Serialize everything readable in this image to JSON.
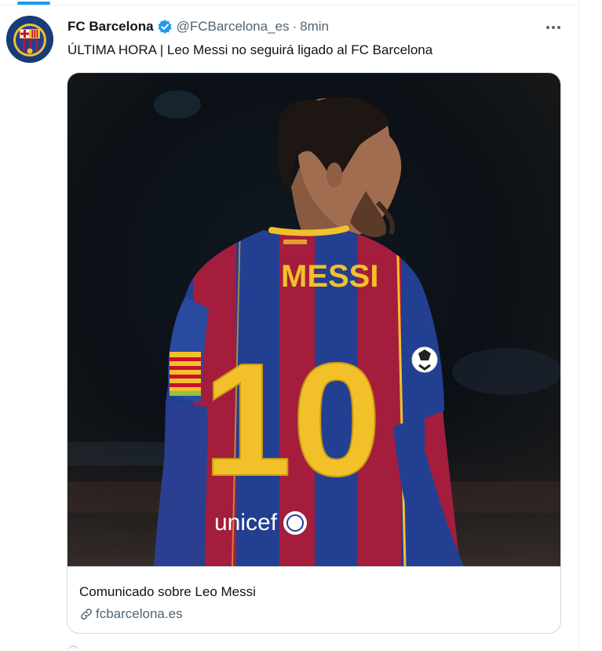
{
  "tweet": {
    "display_name": "FC Barcelona",
    "handle": "@FCBarcelona_es",
    "separator": "·",
    "time": "8min",
    "text": "ÚLTIMA HORA | Leo Messi no seguirá ligado al FC Barcelona",
    "more_icon": "more-horizontal-icon",
    "verified_icon": "verified-badge-icon"
  },
  "card": {
    "title": "Comunicado sobre Leo Messi",
    "domain": "fcbarcelona.es",
    "link_icon": "link-icon",
    "jersey_name": "MESSI",
    "jersey_number": "10",
    "sponsor": "unicef"
  },
  "colors": {
    "accent": "#1d9bf0",
    "text": "#0f1419",
    "secondary_text": "#536471",
    "border": "#cfd9de",
    "jersey_blue": "#233f92",
    "jersey_red": "#a51d3c",
    "jersey_gold": "#f2c12a"
  }
}
